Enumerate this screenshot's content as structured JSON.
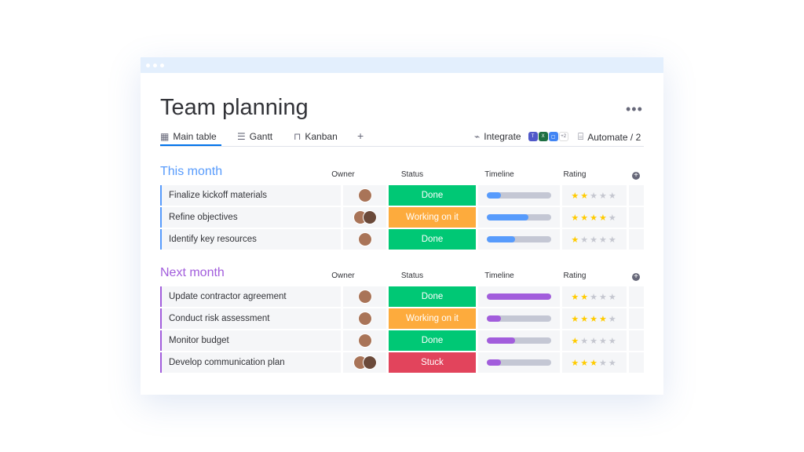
{
  "title": "Team planning",
  "tabs": [
    {
      "label": "Main table",
      "icon": "table-icon"
    },
    {
      "label": "Gantt",
      "icon": "gantt-icon"
    },
    {
      "label": "Kanban",
      "icon": "kanban-icon"
    }
  ],
  "add_tab": "+",
  "integrate": {
    "label": "Integrate",
    "more": "+2"
  },
  "automate": {
    "label": "Automate / 2"
  },
  "columns": {
    "owner": "Owner",
    "status": "Status",
    "timeline": "Timeline",
    "rating": "Rating"
  },
  "colors": {
    "done": "#00c875",
    "working": "#fdab3d",
    "stuck": "#e2445c",
    "this_month": "#579bfc",
    "next_month": "#a25ddc"
  },
  "groups": [
    {
      "title": "This month",
      "color": "#579bfc",
      "rows": [
        {
          "name": "Finalize kickoff materials",
          "owners": 1,
          "status": "Done",
          "timeline": 0.22,
          "rating": 2
        },
        {
          "name": "Refine objectives",
          "owners": 2,
          "status": "Working on it",
          "timeline": 0.65,
          "rating": 4
        },
        {
          "name": "Identify key resources",
          "owners": 1,
          "status": "Done",
          "timeline": 0.44,
          "rating": 1
        }
      ]
    },
    {
      "title": "Next month",
      "color": "#a25ddc",
      "rows": [
        {
          "name": "Update contractor agreement",
          "owners": 1,
          "status": "Done",
          "timeline": 1.0,
          "rating": 2
        },
        {
          "name": "Conduct risk assessment",
          "owners": 1,
          "status": "Working on it",
          "timeline": 0.22,
          "rating": 4
        },
        {
          "name": "Monitor budget",
          "owners": 1,
          "status": "Done",
          "timeline": 0.44,
          "rating": 1
        },
        {
          "name": "Develop communication plan",
          "owners": 2,
          "status": "Stuck",
          "timeline": 0.22,
          "rating": 3
        }
      ]
    }
  ]
}
